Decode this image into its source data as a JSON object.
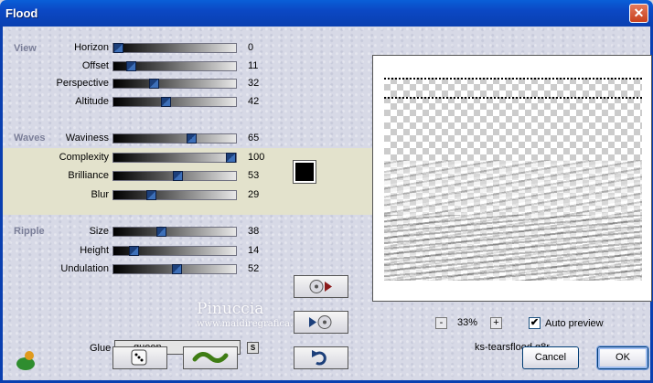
{
  "window": {
    "title": "Flood",
    "close_symbol": "✕"
  },
  "groups": {
    "view": {
      "title": "View",
      "rows": [
        {
          "label": "Horizon",
          "value": "0",
          "level": 0
        },
        {
          "label": "Offset",
          "value": "11",
          "level": 11
        },
        {
          "label": "Perspective",
          "value": "32",
          "level": 32
        },
        {
          "label": "Altitude",
          "value": "42",
          "level": 42
        }
      ]
    },
    "waves": {
      "title": "Waves",
      "color": "#000000",
      "rows": [
        {
          "label": "Waviness",
          "value": "65",
          "level": 65
        },
        {
          "label": "Complexity",
          "value": "100",
          "level": 100
        },
        {
          "label": "Brilliance",
          "value": "53",
          "level": 53
        },
        {
          "label": "Blur",
          "value": "29",
          "level": 29
        }
      ]
    },
    "ripple": {
      "title": "Ripple",
      "rows": [
        {
          "label": "Size",
          "value": "38",
          "level": 38
        },
        {
          "label": "Height",
          "value": "14",
          "level": 14
        },
        {
          "label": "Undulation",
          "value": "52",
          "level": 52
        }
      ]
    }
  },
  "glue": {
    "label": "Glue",
    "value": "queen",
    "button": "S"
  },
  "preview": {
    "zoom": "33%",
    "zoom_minus": "-",
    "zoom_plus": "+",
    "auto_preview_label": "Auto preview",
    "auto_preview_checked": true,
    "preset_name": "ks-tearsflood.q8r"
  },
  "watermark": {
    "line1": "Pinuccia",
    "line2": "www.maidiregrafica.eu"
  },
  "buttons": {
    "cancel": "Cancel",
    "ok": "OK"
  },
  "icons": [
    "plugin-logo-icon",
    "dice-icon",
    "wave-icon",
    "undo-icon",
    "save-preset-icon",
    "load-preset-icon"
  ]
}
